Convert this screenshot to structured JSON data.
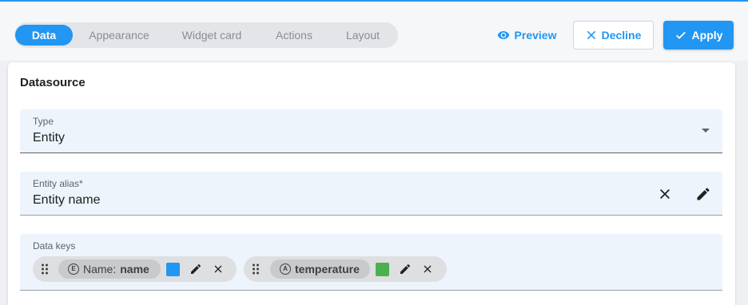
{
  "tabs": [
    {
      "label": "Data",
      "active": true
    },
    {
      "label": "Appearance",
      "active": false
    },
    {
      "label": "Widget card",
      "active": false
    },
    {
      "label": "Actions",
      "active": false
    },
    {
      "label": "Layout",
      "active": false
    }
  ],
  "toolbar": {
    "preview_label": "Preview",
    "decline_label": "Decline",
    "apply_label": "Apply"
  },
  "datasource": {
    "title": "Datasource",
    "type": {
      "label": "Type",
      "value": "Entity"
    },
    "entity_alias": {
      "label": "Entity alias*",
      "value": "Entity name"
    },
    "data_keys": {
      "label": "Data keys",
      "keys": [
        {
          "badge": "E",
          "prefix": "Name:",
          "name": "name",
          "color": "#2196f3",
          "icon": "entity-field-icon"
        },
        {
          "badge": "A",
          "prefix": "",
          "name": "temperature",
          "color": "#4caf50",
          "icon": "attribute-icon"
        }
      ]
    }
  },
  "colors": {
    "accent": "#2196f3",
    "field_bg": "#edf4fc"
  }
}
